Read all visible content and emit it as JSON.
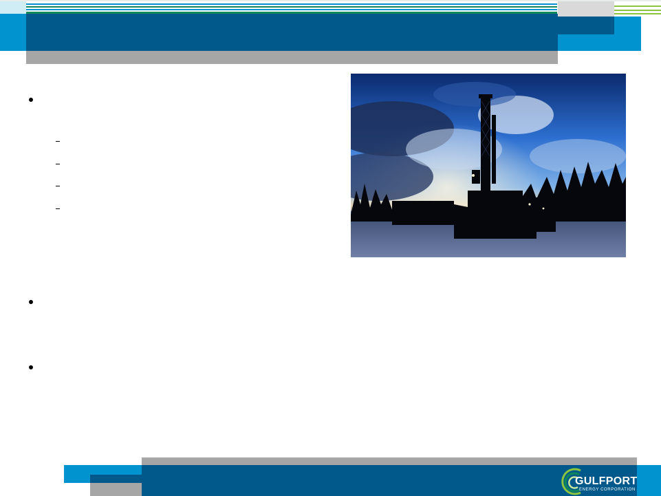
{
  "slide": {
    "title": "",
    "bullets": [
      {
        "text": "",
        "subitems": [
          "",
          "",
          "",
          ""
        ]
      },
      {
        "text": ""
      },
      {
        "text": ""
      }
    ]
  },
  "photo": {
    "subject": "drilling-rig-at-dusk-photo"
  },
  "logo": {
    "name": "GULFPORT",
    "tagline": "ENERGY CORPORATION"
  },
  "colors": {
    "dark_blue": "#00598a",
    "light_blue": "#0093d0",
    "green": "#0e8a5a",
    "light_green": "#8cc63e",
    "gray": "#a6a6a6"
  }
}
